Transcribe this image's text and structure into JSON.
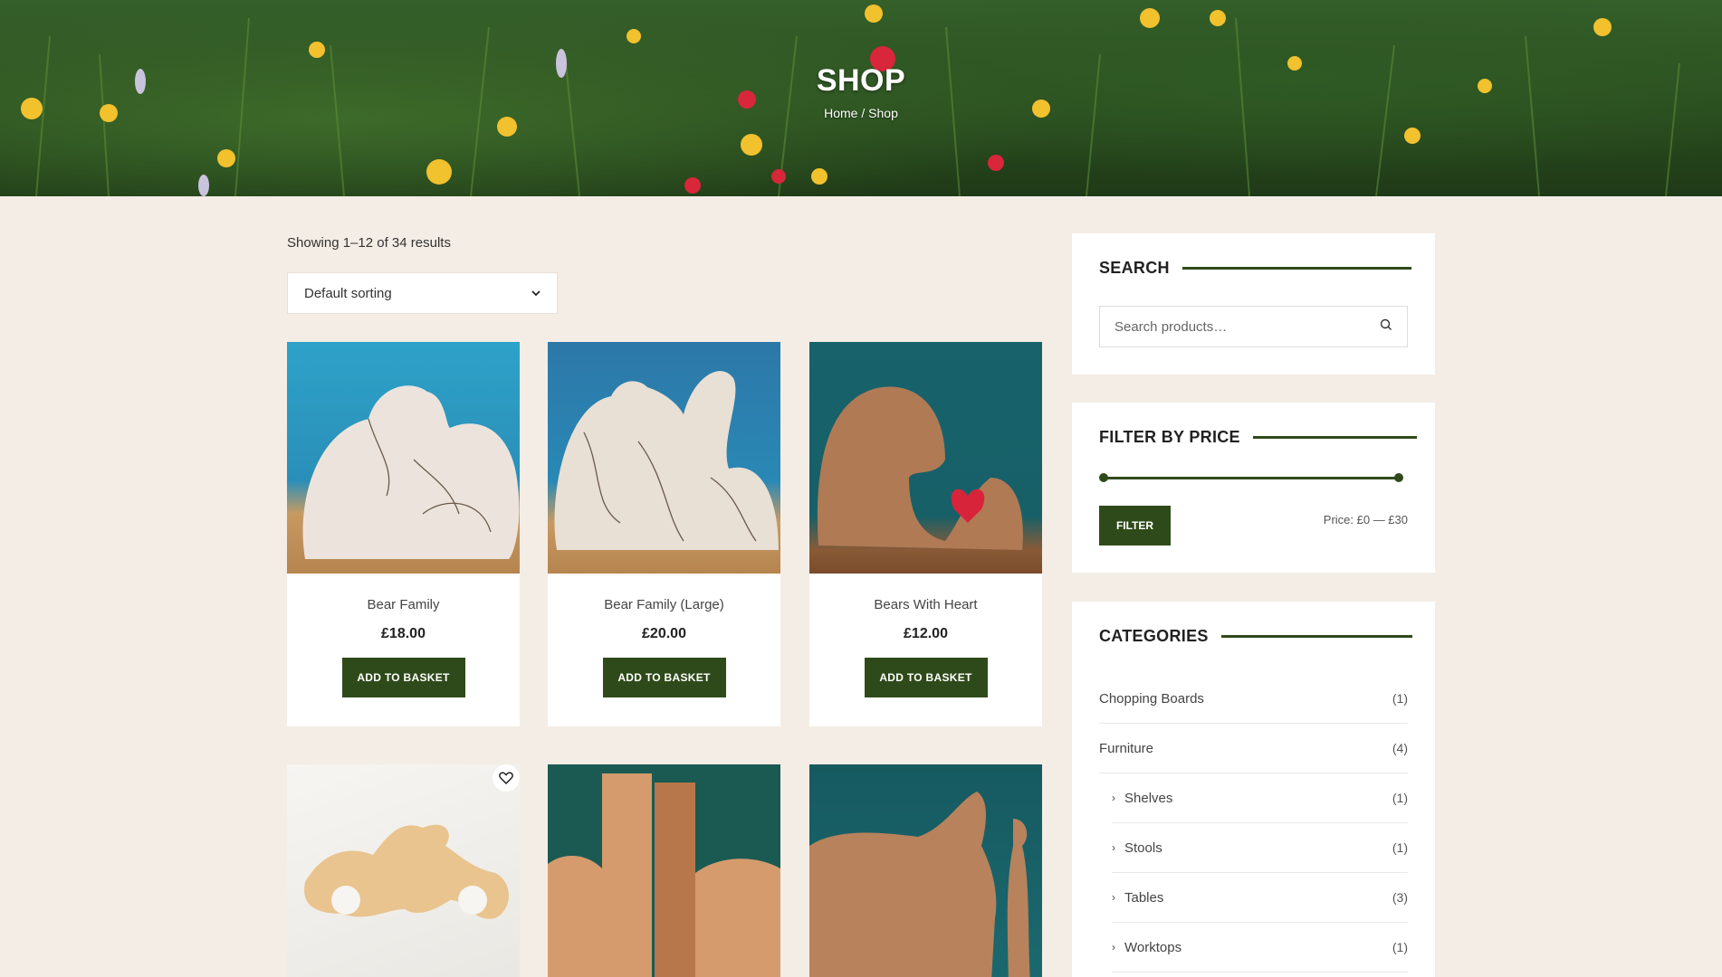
{
  "hero": {
    "title": "SHOP",
    "breadcrumb_home": "Home",
    "breadcrumb_sep": " / ",
    "breadcrumb_current": "Shop"
  },
  "shop": {
    "results": "Showing 1–12 of 34 results",
    "sort_selected": "Default sorting"
  },
  "products": [
    {
      "name": "Bear Family",
      "price": "£18.00",
      "button": "ADD TO BASKET"
    },
    {
      "name": "Bear Family (Large)",
      "price": "£20.00",
      "button": "ADD TO BASKET"
    },
    {
      "name": "Bears With Heart",
      "price": "£12.00",
      "button": "ADD TO BASKET"
    }
  ],
  "sidebar": {
    "search": {
      "title": "SEARCH",
      "placeholder": "Search products…"
    },
    "price_filter": {
      "title": "FILTER BY PRICE",
      "button": "FILTER",
      "price_text": "Price: £0 — £30",
      "min_fraction": 0,
      "max_fraction": 1
    },
    "categories": {
      "title": "CATEGORIES",
      "items": [
        {
          "label": "Chopping Boards",
          "count": "(1)"
        },
        {
          "label": "Furniture",
          "count": "(4)"
        },
        {
          "label": "Shelves",
          "count": "(1)"
        },
        {
          "label": "Stools",
          "count": "(1)"
        },
        {
          "label": "Tables",
          "count": "(3)"
        },
        {
          "label": "Worktops",
          "count": "(1)"
        }
      ]
    }
  }
}
